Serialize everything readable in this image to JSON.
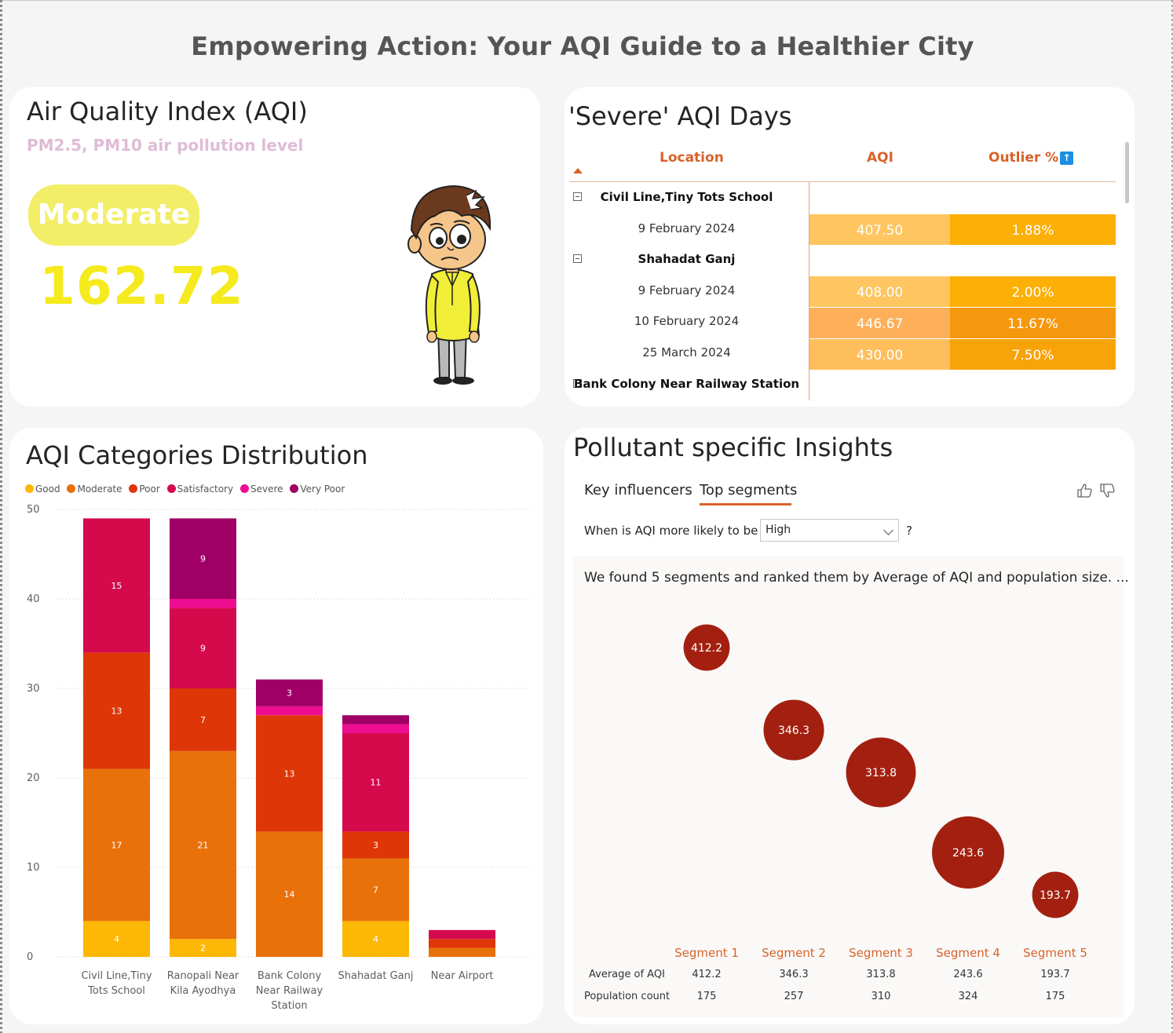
{
  "page_title": "Empowering Action: Your AQI Guide to a Healthier City",
  "aqi_card": {
    "title": "Air Quality Index (AQI)",
    "subtitle": "PM2.5, PM10 air pollution level",
    "category": "Moderate",
    "value": "162.72",
    "colors": {
      "badge": "#f2ee68",
      "value": "#f5ea1e",
      "subtitle": "#dfbcd6"
    }
  },
  "severe_card": {
    "title": "'Severe' AQI Days",
    "columns": [
      "Location",
      "AQI",
      "Outlier %"
    ],
    "sort_indicator": "descending",
    "groups": [
      {
        "location": "Civil Line,Tiny Tots School",
        "rows": [
          {
            "date": "9 February 2024",
            "aqi": "407.50",
            "outlier": "1.88%"
          }
        ]
      },
      {
        "location": "Shahadat Ganj",
        "rows": [
          {
            "date": "9 February 2024",
            "aqi": "408.00",
            "outlier": "2.00%"
          },
          {
            "date": "10 February 2024",
            "aqi": "446.67",
            "outlier": "11.67%"
          },
          {
            "date": "25 March 2024",
            "aqi": "430.00",
            "outlier": "7.50%"
          }
        ]
      },
      {
        "location": "Bank Colony Near Railway Station",
        "rows": []
      }
    ]
  },
  "dist_card": {
    "title": "AQI Categories Distribution",
    "legend": [
      {
        "label": "Good",
        "color": "#fdb705"
      },
      {
        "label": "Moderate",
        "color": "#e8710a"
      },
      {
        "label": "Poor",
        "color": "#df3607"
      },
      {
        "label": "Satisfactory",
        "color": "#d50a4d"
      },
      {
        "label": "Severe",
        "color": "#ee0c90"
      },
      {
        "label": "Very Poor",
        "color": "#a00065"
      }
    ]
  },
  "chart_data": {
    "type": "bar",
    "stacked": true,
    "categories": [
      "Civil Line,Tiny Tots School",
      "Ranopali Near Kila Ayodhya",
      "Bank Colony Near Railway Station",
      "Shahadat Ganj",
      "Near Airport"
    ],
    "series": [
      {
        "name": "Good",
        "values": [
          4,
          2,
          0,
          4,
          0
        ]
      },
      {
        "name": "Moderate",
        "values": [
          17,
          21,
          14,
          7,
          1
        ]
      },
      {
        "name": "Poor",
        "values": [
          13,
          7,
          13,
          3,
          1
        ]
      },
      {
        "name": "Satisfactory",
        "values": [
          15,
          9,
          0,
          11,
          1
        ]
      },
      {
        "name": "Severe",
        "values": [
          0,
          1,
          1,
          1,
          0
        ]
      },
      {
        "name": "Very Poor",
        "values": [
          0,
          9,
          3,
          1,
          0
        ]
      }
    ],
    "ylim": [
      0,
      50
    ],
    "yticks": [
      0,
      10,
      20,
      30,
      40,
      50
    ],
    "grid": true,
    "legend_position": "top-left"
  },
  "insight_card": {
    "title": "Pollutant specific Insights",
    "tabs": [
      "Key influencers",
      "Top segments"
    ],
    "active_tab": "Top segments",
    "question": "When is AQI more likely to be",
    "selected_value": "High",
    "question_mark": "?",
    "summary": "We found 5 segments and ranked them by Average of AQI and population size. ...",
    "row_labels": [
      "Average of AQI",
      "Population count"
    ],
    "bubble_color": "#a32010",
    "segments": [
      {
        "name": "Segment 1",
        "avg": "412.2",
        "count": "175"
      },
      {
        "name": "Segment 2",
        "avg": "346.3",
        "count": "257"
      },
      {
        "name": "Segment 3",
        "avg": "313.8",
        "count": "310"
      },
      {
        "name": "Segment 4",
        "avg": "243.6",
        "count": "324"
      },
      {
        "name": "Segment 5",
        "avg": "193.7",
        "count": "175"
      }
    ]
  }
}
